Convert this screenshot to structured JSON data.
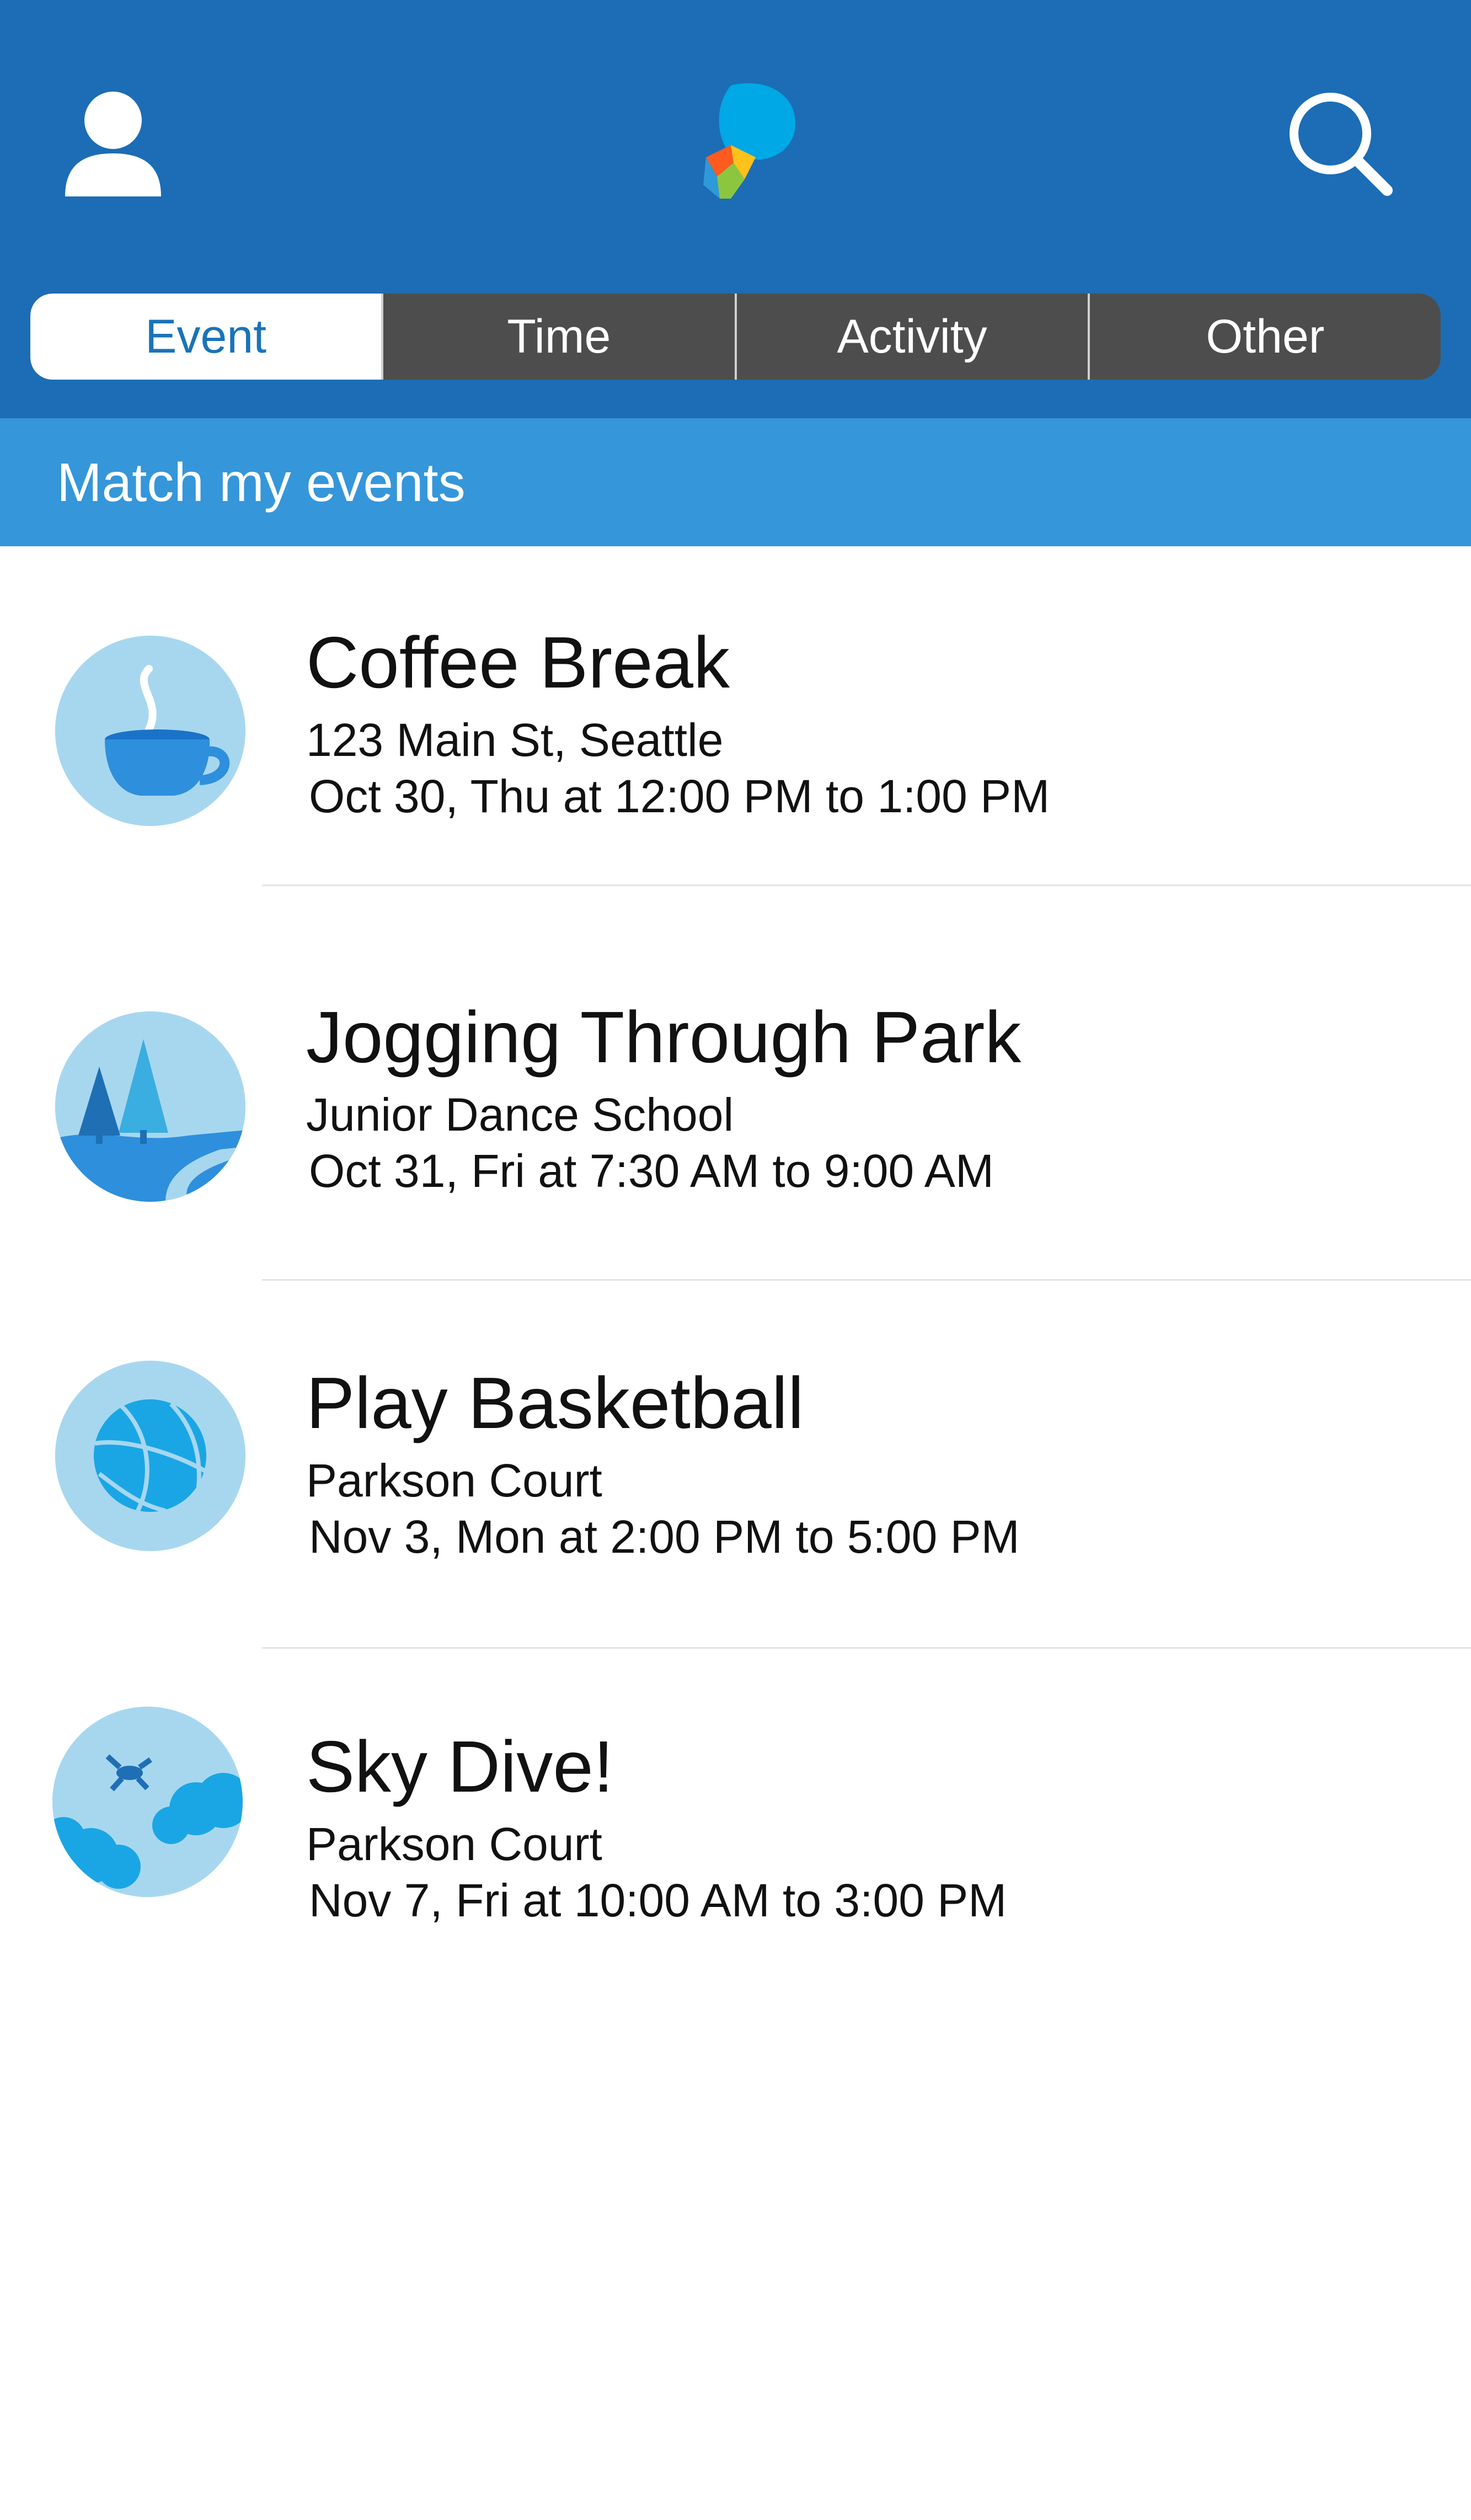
{
  "header": {
    "profile_icon": "user-icon",
    "logo_icon": "app-logo",
    "search_icon": "search-icon",
    "colors": {
      "bar": "#1c6db5",
      "accent": "#3596d9"
    }
  },
  "tabs": [
    {
      "label": "Event",
      "active": true
    },
    {
      "label": "Time",
      "active": false
    },
    {
      "label": "Activity",
      "active": false
    },
    {
      "label": "Other",
      "active": false
    }
  ],
  "subheader": {
    "title": "Match my events"
  },
  "events": [
    {
      "title": "Coffee Break",
      "location": "123 Main St, Seattle",
      "time": "Oct 30, Thu at 12:00 PM to 1:00 PM",
      "icon": "coffee-cup-icon"
    },
    {
      "title": "Jogging Through Park",
      "location": "Junior Dance School",
      "time": "Oct 31, Fri at 7:30 AM to 9:00 AM",
      "icon": "park-trees-icon"
    },
    {
      "title": "Play Basketball",
      "location": "Parkson Court",
      "time": "Nov 3, Mon at 2:00 PM to 5:00 PM",
      "icon": "basketball-icon"
    },
    {
      "title": "Sky Dive!",
      "location": "Parkson Court",
      "time": "Nov 7, Fri at 10:00 AM to 3:00 PM",
      "icon": "skydiver-clouds-icon"
    }
  ]
}
